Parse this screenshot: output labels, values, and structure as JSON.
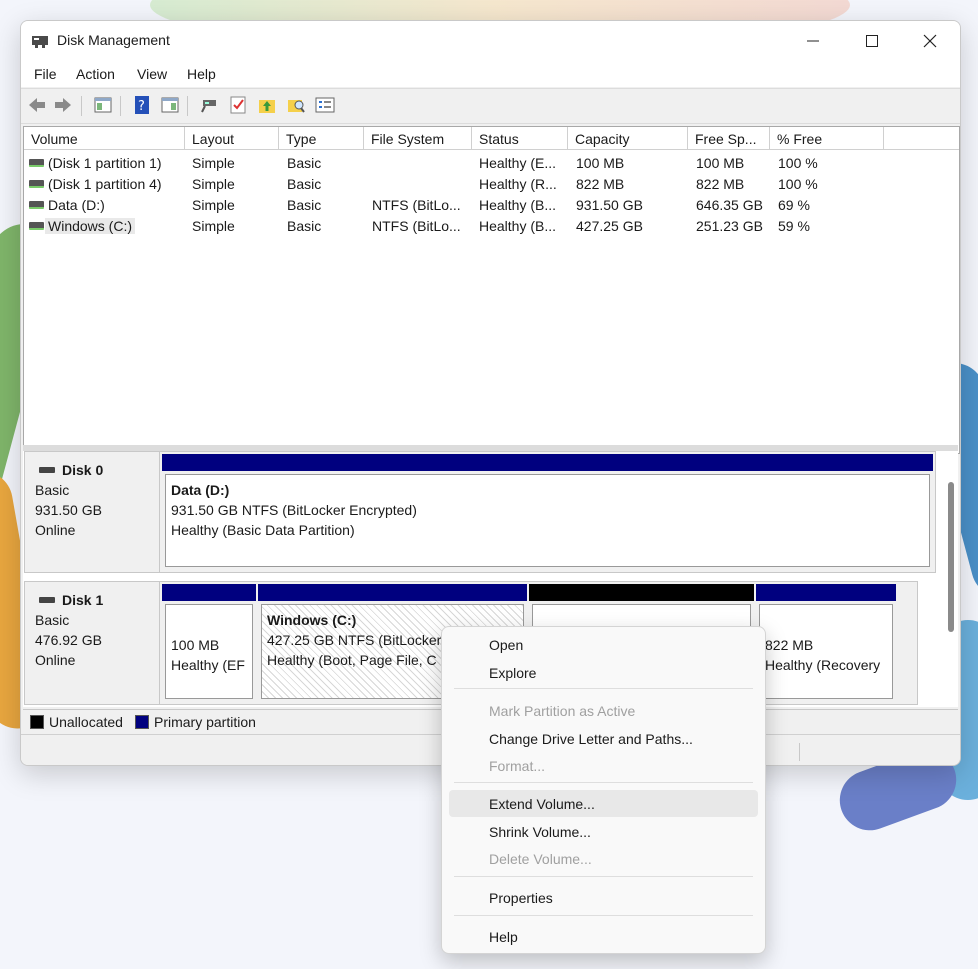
{
  "window": {
    "title": "Disk Management"
  },
  "menubar": [
    "File",
    "Action",
    "View",
    "Help"
  ],
  "toolbar": [
    "back-arrow-icon",
    "forward-arrow-icon",
    "console-tree-icon",
    "help-icon",
    "show-pane-icon",
    "connect-icon",
    "check-icon",
    "folder-up-icon",
    "folder-search-icon",
    "list-icon"
  ],
  "volume_list": {
    "columns": [
      "Volume",
      "Layout",
      "Type",
      "File System",
      "Status",
      "Capacity",
      "Free Sp...",
      "% Free"
    ],
    "rows": [
      {
        "volume": "(Disk 1 partition 1)",
        "layout": "Simple",
        "type": "Basic",
        "fs": "",
        "status": "Healthy (E...",
        "capacity": "100 MB",
        "free": "100 MB",
        "pct": "100 %"
      },
      {
        "volume": "(Disk 1 partition 4)",
        "layout": "Simple",
        "type": "Basic",
        "fs": "",
        "status": "Healthy (R...",
        "capacity": "822 MB",
        "free": "822 MB",
        "pct": "100 %"
      },
      {
        "volume": "Data (D:)",
        "layout": "Simple",
        "type": "Basic",
        "fs": "NTFS (BitLo...",
        "status": "Healthy (B...",
        "capacity": "931.50 GB",
        "free": "646.35 GB",
        "pct": "69 %"
      },
      {
        "volume": "Windows (C:)",
        "layout": "Simple",
        "type": "Basic",
        "fs": "NTFS (BitLo...",
        "status": "Healthy (B...",
        "capacity": "427.25 GB",
        "free": "251.23 GB",
        "pct": "59 %"
      }
    ]
  },
  "disks": [
    {
      "name": "Disk 0",
      "type": "Basic",
      "size": "931.50 GB",
      "state": "Online",
      "partitions": [
        {
          "title": "Data  (D:)",
          "line1": "931.50 GB NTFS (BitLocker Encrypted)",
          "line2": "Healthy (Basic Data Partition)"
        }
      ]
    },
    {
      "name": "Disk 1",
      "type": "Basic",
      "size": "476.92 GB",
      "state": "Online",
      "partitions": [
        {
          "title": "",
          "line1": "100 MB",
          "line2": "Healthy (EF"
        },
        {
          "title": "Windows  (C:)",
          "line1": "427.25 GB NTFS (BitLocker",
          "line2": "Healthy (Boot, Page File, C"
        },
        {
          "title": "",
          "line1": "",
          "line2": ""
        },
        {
          "title": "",
          "line1": "822 MB",
          "line2": "Healthy (Recovery"
        }
      ]
    }
  ],
  "legend": {
    "unallocated": "Unallocated",
    "primary": "Primary partition"
  },
  "context_menu": [
    {
      "label": "Open",
      "enabled": true
    },
    {
      "label": "Explore",
      "enabled": true
    },
    {
      "label": "Mark Partition as Active",
      "enabled": false
    },
    {
      "label": "Change Drive Letter and Paths...",
      "enabled": true
    },
    {
      "label": "Format...",
      "enabled": false
    },
    {
      "label": "Extend Volume...",
      "enabled": true,
      "highlighted": true
    },
    {
      "label": "Shrink Volume...",
      "enabled": true
    },
    {
      "label": "Delete Volume...",
      "enabled": false
    },
    {
      "label": "Properties",
      "enabled": true
    },
    {
      "label": "Help",
      "enabled": true
    }
  ],
  "colors": {
    "primary_partition": "#00007f",
    "unallocated": "#000000"
  }
}
